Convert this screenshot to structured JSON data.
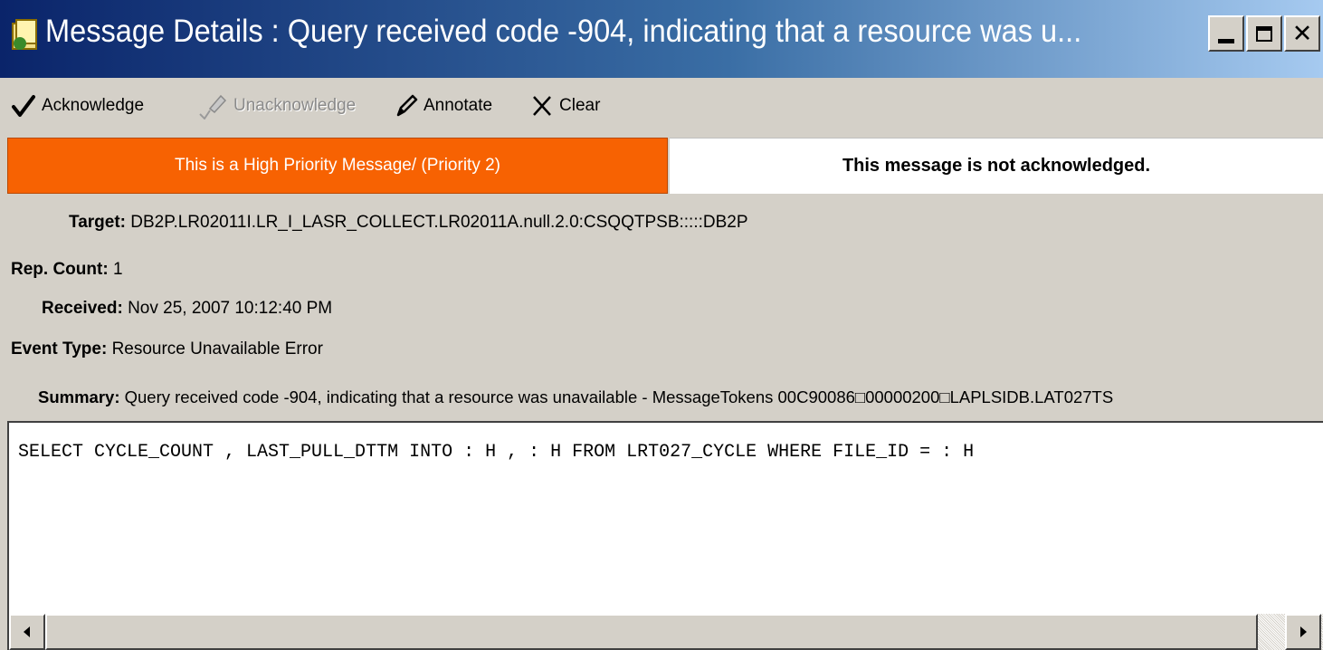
{
  "window": {
    "title": "Message Details : Query received code -904, indicating that a resource was u...",
    "icon": "message-app-icon",
    "controls": {
      "minimize": "minimize-icon",
      "maximize": "maximize-icon",
      "close": "close-icon"
    }
  },
  "toolbar": {
    "acknowledge_label": "Acknowledge",
    "unacknowledge_label": "Unacknowledge",
    "annotate_label": "Annotate",
    "clear_label": "Clear",
    "icons": [
      "checkmark-icon",
      "unacknowledge-icon",
      "pencil-icon",
      "clear-x-icon"
    ]
  },
  "status": {
    "priority_text": "This is a High Priority Message/ (Priority 2)",
    "ack_text": "This message is not acknowledged.",
    "priority_color": "#f76202"
  },
  "details": {
    "target_label": "Target:",
    "target_value": "DB2P.LR02011I.LR_I_LASR_COLLECT.LR02011A.null.2.0:CSQQTPSB:::::DB2P",
    "rep_count_label": "Rep. Count:",
    "rep_count_value": "1",
    "received_label": "Received:",
    "received_value": "Nov 25, 2007 10:12:40 PM",
    "event_type_label": "Event Type:",
    "event_type_value": "Resource Unavailable Error",
    "summary_label": "Summary:",
    "summary_value": "Query received code -904, indicating that a resource was unavailable - MessageTokens 00C90086□00000200□LAPLSIDB.LAT027TS"
  },
  "message_body": {
    "text": "SELECT CYCLE_COUNT , LAST_PULL_DTTM INTO : H , : H FROM LRT027_CYCLE WHERE FILE_ID = : H"
  }
}
